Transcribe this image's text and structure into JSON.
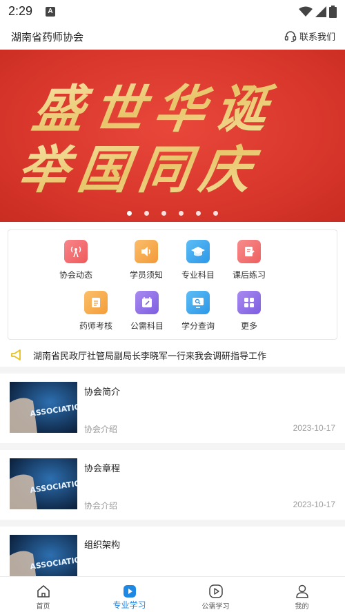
{
  "status_bar": {
    "time": "2:29",
    "badge": "A"
  },
  "header": {
    "title": "湖南省药师协会",
    "contact_label": "联系我们"
  },
  "banner": {
    "headline_line1": "盛世华诞",
    "headline_line2": "举国同庆",
    "slide_count": 6,
    "active_slide": 1
  },
  "grid": {
    "items": [
      {
        "label": "协会动态",
        "icon": "broadcast-icon",
        "color": "#f0686a"
      },
      {
        "label": "学员须知",
        "icon": "speaker-icon",
        "color": "#f7a44a"
      },
      {
        "label": "专业科目",
        "icon": "graduation-cap-icon",
        "color": "#3fa9f0"
      },
      {
        "label": "课后练习",
        "icon": "edit-note-icon",
        "color": "#f26d6d"
      },
      {
        "label": "药师考核",
        "icon": "clipboard-icon",
        "color": "#f6a53c"
      },
      {
        "label": "公需科目",
        "icon": "calendar-edit-icon",
        "color": "#8e6de6"
      },
      {
        "label": "学分查询",
        "icon": "monitor-search-icon",
        "color": "#3fa9f0"
      },
      {
        "label": "更多",
        "icon": "grid-more-icon",
        "color": "#8e6de6"
      }
    ]
  },
  "notice": {
    "text": "湖南省民政厅社管局副局长李晓军一行来我会调研指导工作"
  },
  "articles": [
    {
      "title": "协会简介",
      "category": "协会介绍",
      "date": "2023-10-17",
      "thumb_text": "ASSOCIATION"
    },
    {
      "title": "协会章程",
      "category": "协会介绍",
      "date": "2023-10-17",
      "thumb_text": "ASSOCIATION"
    },
    {
      "title": "组织架构",
      "category": "",
      "date": "",
      "thumb_text": "ASSOCIATION"
    }
  ],
  "tabbar": {
    "tabs": [
      {
        "label": "首页",
        "icon": "home-icon"
      },
      {
        "label": "专业学习",
        "icon": "play-icon"
      },
      {
        "label": "公需学习",
        "icon": "play-circle-icon"
      },
      {
        "label": "我的",
        "icon": "user-icon"
      }
    ],
    "active_tab": 1,
    "active_color": "#1e88e5"
  }
}
